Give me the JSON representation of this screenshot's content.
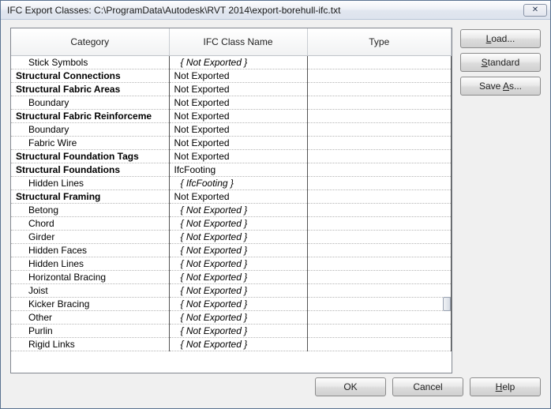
{
  "title": "IFC Export Classes: C:\\ProgramData\\Autodesk\\RVT 2014\\export-borehull-ifc.txt",
  "close_glyph": "✕",
  "headers": {
    "category": "Category",
    "ifc": "IFC Class Name",
    "type": "Type"
  },
  "buttons": {
    "load": "Load...",
    "standard": "Standard",
    "saveas": "Save As...",
    "ok": "OK",
    "cancel": "Cancel",
    "help": "Help"
  },
  "underline": {
    "load": "L",
    "standard": "S",
    "saveas": "A",
    "help": "H"
  },
  "rows": [
    {
      "cat": "Stick Symbols",
      "ifc": "{ Not Exported }",
      "type": "",
      "sub": true,
      "italic": true
    },
    {
      "cat": "Structural Connections",
      "ifc": "Not Exported",
      "type": "",
      "bold": true
    },
    {
      "cat": "Structural Fabric Areas",
      "ifc": "Not Exported",
      "type": "",
      "bold": true
    },
    {
      "cat": "Boundary",
      "ifc": "Not Exported",
      "type": "",
      "sub": true
    },
    {
      "cat": "Structural Fabric Reinforceme",
      "ifc": "Not Exported",
      "type": "",
      "bold": true
    },
    {
      "cat": "Boundary",
      "ifc": "Not Exported",
      "type": "",
      "sub": true
    },
    {
      "cat": "Fabric Wire",
      "ifc": "Not Exported",
      "type": "",
      "sub": true
    },
    {
      "cat": "Structural Foundation Tags",
      "ifc": "Not Exported",
      "type": "",
      "bold": true
    },
    {
      "cat": "Structural Foundations",
      "ifc": "IfcFooting",
      "type": "",
      "bold": true
    },
    {
      "cat": "Hidden Lines",
      "ifc": "{ IfcFooting }",
      "type": "",
      "sub": true,
      "italic": true
    },
    {
      "cat": "Structural Framing",
      "ifc": "Not Exported",
      "type": "",
      "bold": true
    },
    {
      "cat": "Betong",
      "ifc": "{ Not Exported }",
      "type": "",
      "sub": true,
      "italic": true
    },
    {
      "cat": "Chord",
      "ifc": "{ Not Exported }",
      "type": "",
      "sub": true,
      "italic": true
    },
    {
      "cat": "Girder",
      "ifc": "{ Not Exported }",
      "type": "",
      "sub": true,
      "italic": true
    },
    {
      "cat": "Hidden Faces",
      "ifc": "{ Not Exported }",
      "type": "",
      "sub": true,
      "italic": true
    },
    {
      "cat": "Hidden Lines",
      "ifc": "{ Not Exported }",
      "type": "",
      "sub": true,
      "italic": true
    },
    {
      "cat": "Horizontal Bracing",
      "ifc": "{ Not Exported }",
      "type": "",
      "sub": true,
      "italic": true
    },
    {
      "cat": "Joist",
      "ifc": "{ Not Exported }",
      "type": "",
      "sub": true,
      "italic": true
    },
    {
      "cat": "Kicker Bracing",
      "ifc": "{ Not Exported }",
      "type": "",
      "sub": true,
      "italic": true
    },
    {
      "cat": "Other",
      "ifc": "{ Not Exported }",
      "type": "",
      "sub": true,
      "italic": true
    },
    {
      "cat": "Purlin",
      "ifc": "{ Not Exported }",
      "type": "",
      "sub": true,
      "italic": true
    },
    {
      "cat": "Rigid Links",
      "ifc": "{ Not Exported }",
      "type": "",
      "sub": true,
      "italic": true
    }
  ]
}
